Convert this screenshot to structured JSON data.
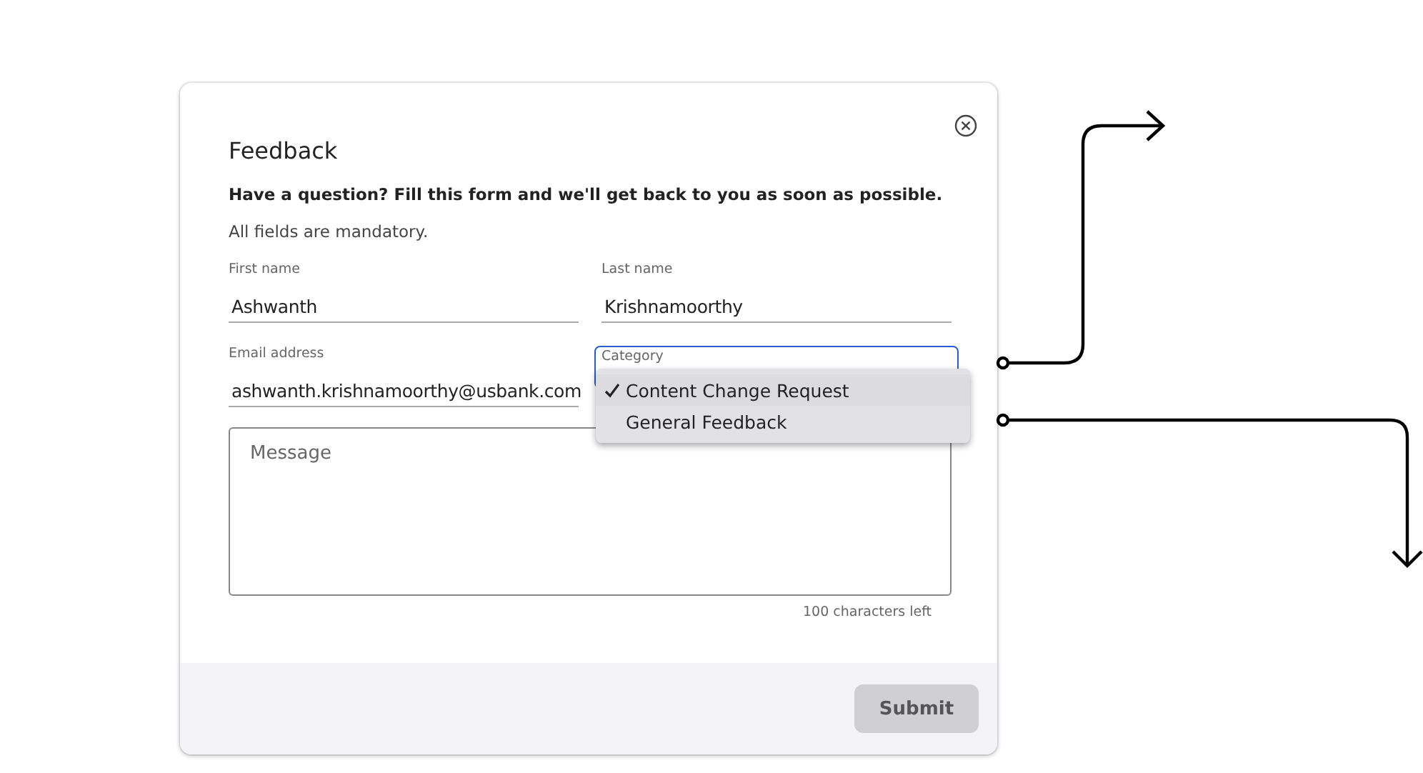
{
  "dialog": {
    "title": "Feedback",
    "intro": "Have a question? Fill this form and we'll get back to you as soon as possible.",
    "note": "All fields are mandatory.",
    "fields": [
      {
        "kind": "text",
        "label": "First name",
        "value": "Ashwanth"
      },
      {
        "kind": "text",
        "label": "Last name",
        "value": "Krishnamoorthy"
      },
      {
        "kind": "text",
        "label": "Email address",
        "value": "ashwanth.krishnamoorthy@usbank.com"
      },
      {
        "kind": "select",
        "label": "Category",
        "focused": true,
        "expanded": true
      }
    ],
    "menu": [
      {
        "label": "Content Change Request",
        "selected": true
      },
      {
        "label": "General Feedback",
        "selected": false
      }
    ],
    "message": {
      "placeholder": "Message"
    },
    "counter": "100 characters left",
    "submit": {
      "label": "Submit",
      "disabled": true
    }
  }
}
